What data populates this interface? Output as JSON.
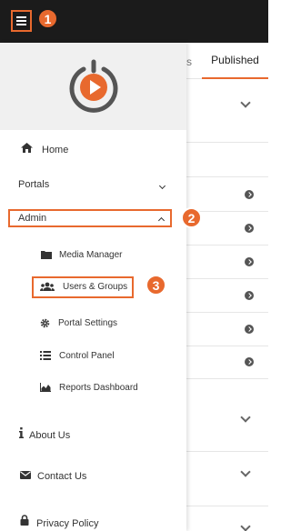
{
  "topbar": {
    "menu_icon": "hamburger-icon",
    "step_badges": [
      "1",
      "2",
      "3"
    ]
  },
  "background_page": {
    "tab_partial": "s",
    "tab_active": "Published"
  },
  "drawer": {
    "logo": "play-logo",
    "nav": {
      "home": "Home",
      "portals": "Portals",
      "admin": "Admin",
      "admin_items": {
        "media_manager": "Media Manager",
        "users_groups": "Users & Groups",
        "portal_settings": "Portal Settings",
        "control_panel": "Control Panel",
        "reports_dashboard": "Reports Dashboard"
      },
      "about_us": "About Us",
      "contact_us": "Contact Us",
      "privacy_policy": "Privacy Policy"
    }
  },
  "colors": {
    "accent": "#e8692e",
    "topbar": "#1b1b1b",
    "logo_bg": "#f0f0f0"
  }
}
